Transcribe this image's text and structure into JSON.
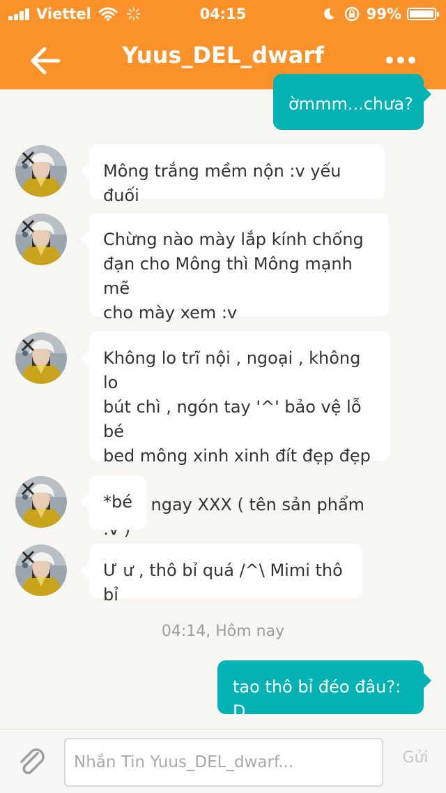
{
  "status_bar": {
    "carrier": "Viettel",
    "time": "04:15",
    "battery": "99%",
    "battery_level": 0.99
  },
  "header": {
    "title": "Yuus_DEL_dwarf",
    "color": "#fb9129"
  },
  "messages": [
    {
      "type": "outgoing",
      "text": "ờmmm...chưa?"
    },
    {
      "type": "incoming",
      "text": "Mông trắng mềm nộn :v yếu đuối"
    },
    {
      "type": "incoming",
      "lines": [
        "Chừng nào mày lắp kính chống",
        "đạn cho Mông thì Mông mạnh mẽ",
        "cho mày xem :v"
      ]
    },
    {
      "type": "incoming",
      "lines": [
        "Không lo trĩ nội , ngoại , không lo",
        "bút chì , ngón tay '^' bảo vệ lỗ bé",
        "bed mông xinh xinh đít đẹp đẹp ,",
        "dùng ngay XXX ( tên sản phẩm :v )"
      ]
    },
    {
      "type": "incoming",
      "text": "*bé"
    },
    {
      "type": "incoming",
      "text": "Ư ư , thô bỉ quá /^\\ Mimi thô bỉ"
    },
    {
      "type": "outgoing",
      "text": "tao thô bỉ đéo đâu?: D"
    }
  ],
  "timestamp": "04:14, Hôm nay",
  "input": {
    "placeholder": "Nhắn Tin Yuus_DEL_dwarf...",
    "value": ""
  },
  "send_label": "Gửi",
  "colors": {
    "accent": "#fb9129",
    "outgoing_bubble": "#03b2b2",
    "background": "#f7f6f2"
  },
  "icons": {
    "back": "back-arrow-icon",
    "more": "more-dots-icon",
    "attach": "paperclip-icon",
    "wifi": "wifi-icon",
    "alarm": "alarm-icon",
    "moon": "moon-icon",
    "lock": "rotation-lock-icon"
  }
}
